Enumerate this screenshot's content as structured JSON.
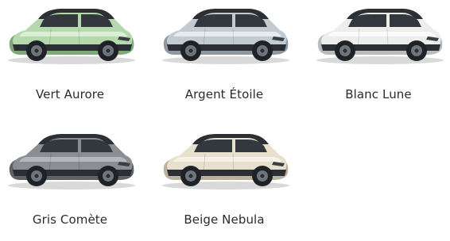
{
  "colors": [
    {
      "name": "Vert Aurore",
      "body": "#b5d9ad",
      "dark": "#7ea877",
      "light": "#dcefd6"
    },
    {
      "name": "Argent Étoile",
      "body": "#c3cbd2",
      "dark": "#8e98a2",
      "light": "#e6ebef"
    },
    {
      "name": "Blanc Lune",
      "body": "#ededeb",
      "dark": "#b9bcbd",
      "light": "#fafafa"
    },
    {
      "name": "Gris Comète",
      "body": "#8a8e93",
      "dark": "#5e6267",
      "light": "#b4b8bc"
    },
    {
      "name": "Beige Nebula",
      "body": "#e7e0cc",
      "dark": "#b9b19a",
      "light": "#f5f1e6"
    }
  ]
}
